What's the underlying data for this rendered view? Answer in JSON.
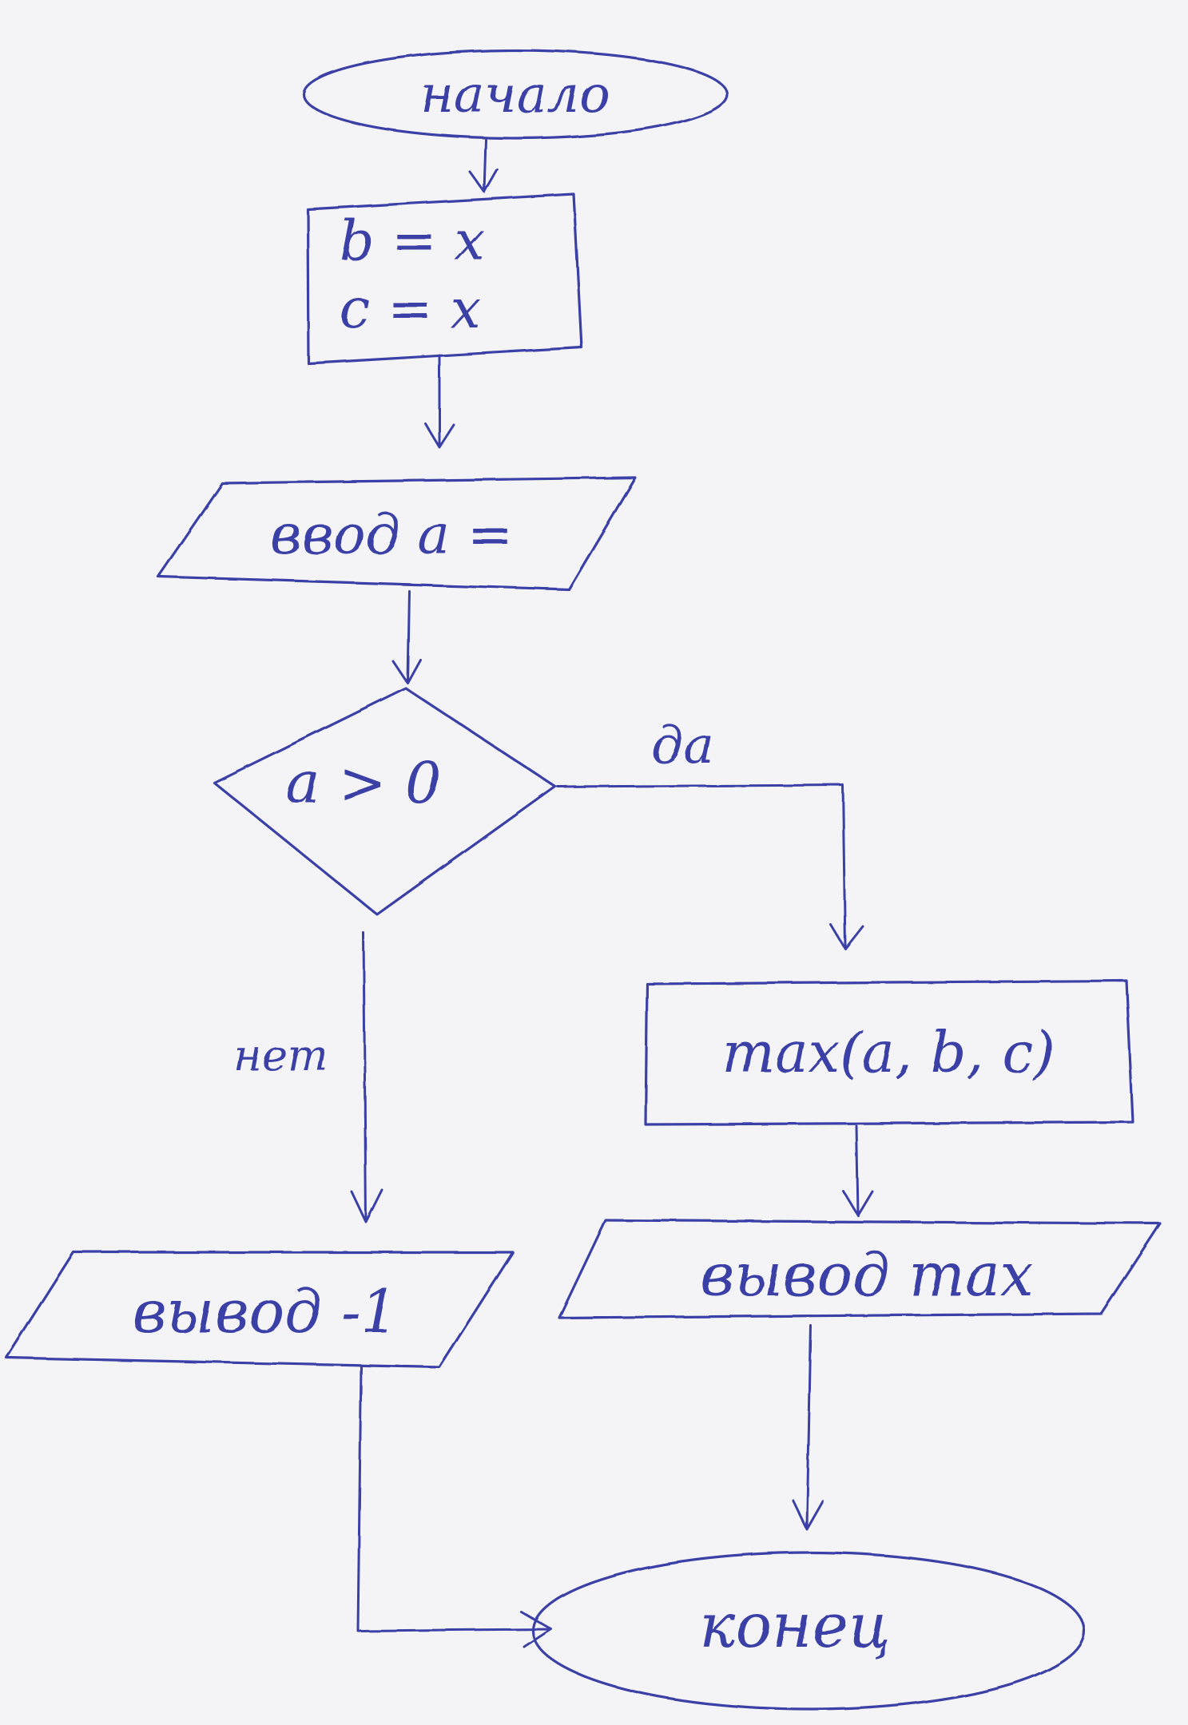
{
  "colors": {
    "ink": "#3a3fa6",
    "paper": "#f4f4f6"
  },
  "nodes": {
    "start": {
      "label": "начало"
    },
    "init": {
      "line1": "b = x",
      "line2": "c = x"
    },
    "input": {
      "label": "ввод a ="
    },
    "decision": {
      "label": "a > 0"
    },
    "max_calc": {
      "label": "max(a, b, c)"
    },
    "output_neg": {
      "label": "вывод -1"
    },
    "output_max": {
      "label": "вывод max"
    },
    "end": {
      "label": "конец"
    }
  },
  "edges": {
    "yes_label": "да",
    "no_label": "нет"
  }
}
